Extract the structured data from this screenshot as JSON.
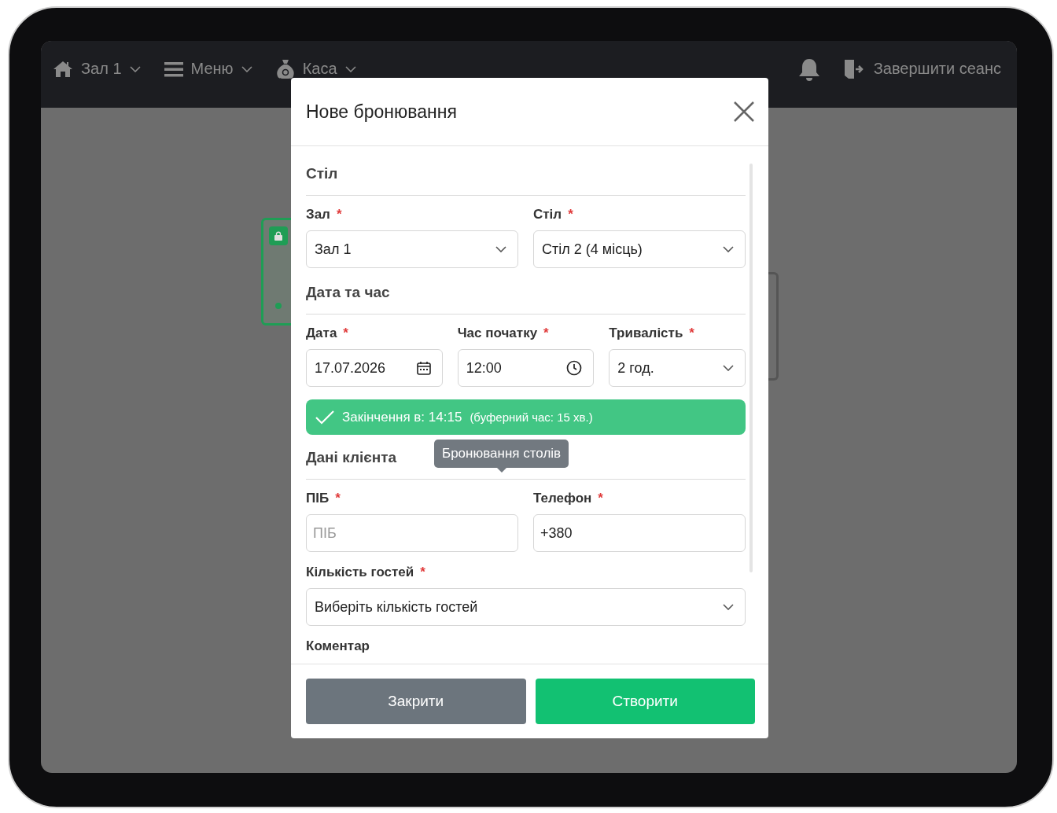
{
  "nav": {
    "items": [
      {
        "label": "Зал 1"
      },
      {
        "label": "Меню"
      },
      {
        "label": "Каса"
      }
    ],
    "logout": "Завершити сеанс"
  },
  "modal": {
    "title": "Нове бронювання",
    "sections": [
      {
        "title": "Стіл",
        "rows": [
          [
            {
              "label": "Зал",
              "required_mark": "*",
              "kind": "select",
              "value": "Зал 1"
            },
            {
              "label": "Стіл",
              "required_mark": "*",
              "kind": "select",
              "value": "Стіл 2 (4 місць)"
            }
          ]
        ]
      },
      {
        "title": "Дата та час",
        "rows": [
          [
            {
              "label": "Дата",
              "required_mark": "*",
              "kind": "date",
              "value": "17.07.2026"
            },
            {
              "label": "Час початку",
              "required_mark": "*",
              "kind": "time",
              "value": "12:00"
            },
            {
              "label": "Тривалість",
              "required_mark": "*",
              "kind": "select",
              "value": "2 год."
            }
          ]
        ],
        "notice": {
          "text": "Закінчення в: 14:15",
          "note": "(буферний час: 15 хв.)"
        }
      },
      {
        "title": "Дані клієнта",
        "tooltip": "Бронювання столів",
        "rows": [
          [
            {
              "label": "ПІБ",
              "required_mark": "*",
              "kind": "text",
              "placeholder": "ПІБ"
            },
            {
              "label": "Телефон",
              "required_mark": "*",
              "kind": "text",
              "value": "+380"
            }
          ],
          [
            {
              "label": "Кількість гостей",
              "required_mark": "*",
              "kind": "select",
              "value": "Виберіть кількість гостей"
            }
          ],
          [
            {
              "label": "Коментар",
              "kind": "label"
            }
          ]
        ]
      }
    ],
    "buttons": [
      {
        "label": "Закрити",
        "kind": "secondary"
      },
      {
        "label": "Створити",
        "kind": "primary"
      }
    ]
  }
}
